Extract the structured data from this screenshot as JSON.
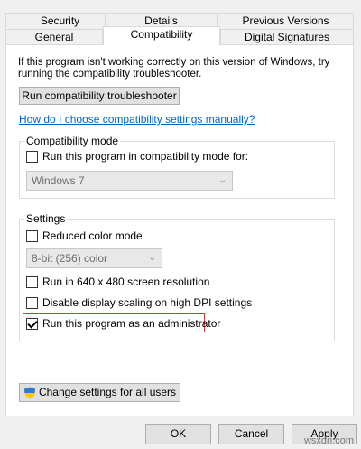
{
  "tabs": {
    "row1": [
      "Security",
      "Details",
      "Previous Versions"
    ],
    "row2": [
      "General",
      "Compatibility",
      "Digital Signatures"
    ]
  },
  "intro": {
    "text": "If this program isn't working correctly on this version of Windows, try running the compatibility troubleshooter."
  },
  "buttons": {
    "troubleshooter": "Run compatibility troubleshooter",
    "change_all_users": "Change settings for all users",
    "ok": "OK",
    "cancel": "Cancel",
    "apply": "Apply"
  },
  "link": {
    "text": "How do I choose compatibility settings manually?"
  },
  "compat_mode": {
    "label": "Compatibility mode",
    "checkbox": "Run this program in compatibility mode for:",
    "checked": false,
    "select_value": "Windows 7"
  },
  "settings": {
    "label": "Settings",
    "reduced_color": {
      "label": "Reduced color mode",
      "checked": false
    },
    "color_select_value": "8-bit (256) color",
    "resolution": {
      "label": "Run in 640 x 480 screen resolution",
      "checked": false
    },
    "dpi": {
      "label": "Disable display scaling on high DPI settings",
      "checked": false
    },
    "admin": {
      "label": "Run this program as an administrator",
      "checked": true
    }
  },
  "watermark": "wsxdn.com",
  "colors": {
    "accent": "#0078d7",
    "highlight": "#d03c3c",
    "link": "#0066cc"
  }
}
